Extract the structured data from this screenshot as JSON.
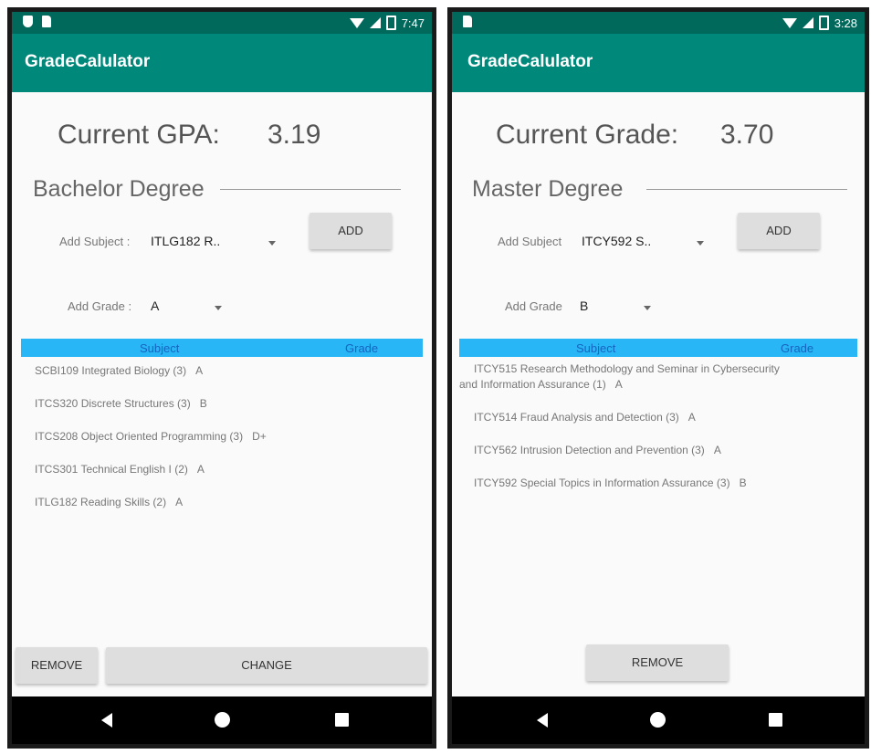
{
  "left": {
    "status": {
      "time": "7:47"
    },
    "app_title": "GradeCalulator",
    "gpa_label": "Current GPA:",
    "gpa_value": "3.19",
    "degree": "Bachelor Degree",
    "add_subject_label": "Add Subject :",
    "subject_selected": "ITLG182 R..",
    "add_button": "ADD",
    "add_grade_label": "Add Grade :",
    "grade_selected": "A",
    "table_headers": {
      "subject": "Subject",
      "grade": "Grade"
    },
    "rows": [
      {
        "subject": "SCBI109 Integrated Biology (3)",
        "grade": "A"
      },
      {
        "subject": "ITCS320 Discrete Structures (3)",
        "grade": "B"
      },
      {
        "subject": "ITCS208 Object Oriented Programming (3)",
        "grade": "D+"
      },
      {
        "subject": "ITCS301 Technical English I (2)",
        "grade": "A"
      },
      {
        "subject": "ITLG182 Reading Skills (2)",
        "grade": "A"
      }
    ],
    "remove_button": "REMOVE",
    "change_button": "CHANGE"
  },
  "right": {
    "status": {
      "time": "3:28"
    },
    "app_title": "GradeCalulator",
    "gpa_label": "Current Grade:",
    "gpa_value": "3.70",
    "degree": "Master Degree",
    "add_subject_label": "Add Subject",
    "subject_selected": "ITCY592 S..",
    "add_button": "ADD",
    "add_grade_label": "Add Grade",
    "grade_selected": "B",
    "table_headers": {
      "subject": "Subject",
      "grade": "Grade"
    },
    "rows": [
      {
        "subject": "ITCY515 Research Methodology and Seminar in Cybersecurity and Information Assurance (1)",
        "grade": "A"
      },
      {
        "subject": "ITCY514 Fraud Analysis and Detection (3)",
        "grade": "A"
      },
      {
        "subject": "ITCY562 Intrusion Detection and Prevention (3)",
        "grade": "A"
      },
      {
        "subject": "ITCY592 Special Topics in Information Assurance (3)",
        "grade": "B"
      }
    ],
    "remove_button": "REMOVE"
  },
  "icons": {
    "status_left": [
      "shield-icon",
      "sd-card-icon"
    ],
    "status_right": [
      "wifi-icon",
      "signal-icon",
      "battery-icon"
    ],
    "nav": [
      "back-icon",
      "home-icon",
      "recents-icon"
    ]
  },
  "colors": {
    "status_bar": "#00695c",
    "app_bar": "#00897b",
    "table_header": "#29b6f6",
    "table_header_text": "#1565c0",
    "button_bg": "#dedede",
    "nav_bar": "#000000"
  }
}
